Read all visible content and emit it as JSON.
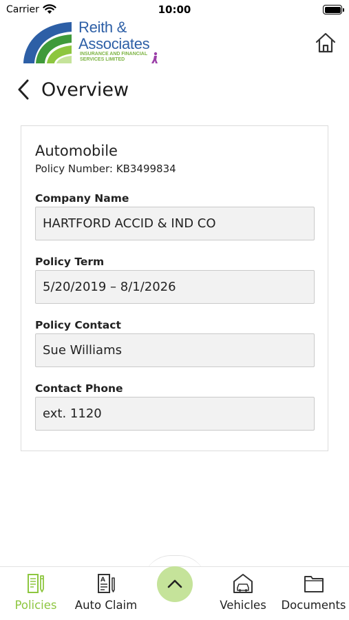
{
  "status_bar": {
    "carrier": "Carrier",
    "time": "10:00"
  },
  "header": {
    "logo": {
      "name_line1": "Reith &",
      "name_line2": "Associates",
      "tagline_line1": "INSURANCE AND FINANCIAL",
      "tagline_line2": "SERVICES LIMITED"
    },
    "home_icon": "home-icon"
  },
  "page": {
    "title": "Overview",
    "back_icon": "chevron-left-icon"
  },
  "policy": {
    "type": "Automobile",
    "number_text": "Policy Number: KB3499834",
    "fields": [
      {
        "label": "Company Name",
        "value": "HARTFORD ACCID & IND CO"
      },
      {
        "label": "Policy Term",
        "value": "5/20/2019 – 8/1/2026"
      },
      {
        "label": "Policy Contact",
        "value": "Sue Williams"
      },
      {
        "label": "Contact Phone",
        "value": "ext. 1120"
      }
    ]
  },
  "tab_bar": {
    "tabs": [
      {
        "label": "Policies",
        "icon": "policy-document-icon",
        "active": true
      },
      {
        "label": "Auto Claim",
        "icon": "claim-form-icon",
        "active": false
      },
      {
        "label": "Vehicles",
        "icon": "car-garage-icon",
        "active": false
      },
      {
        "label": "Documents",
        "icon": "folder-icon",
        "active": false
      }
    ],
    "center_button_icon": "chevron-up-icon"
  },
  "colors": {
    "accent_green": "#8dc63f",
    "center_button": "#c5e39a",
    "logo_blue": "#2d5fa6",
    "field_background": "#f2f2f2"
  }
}
